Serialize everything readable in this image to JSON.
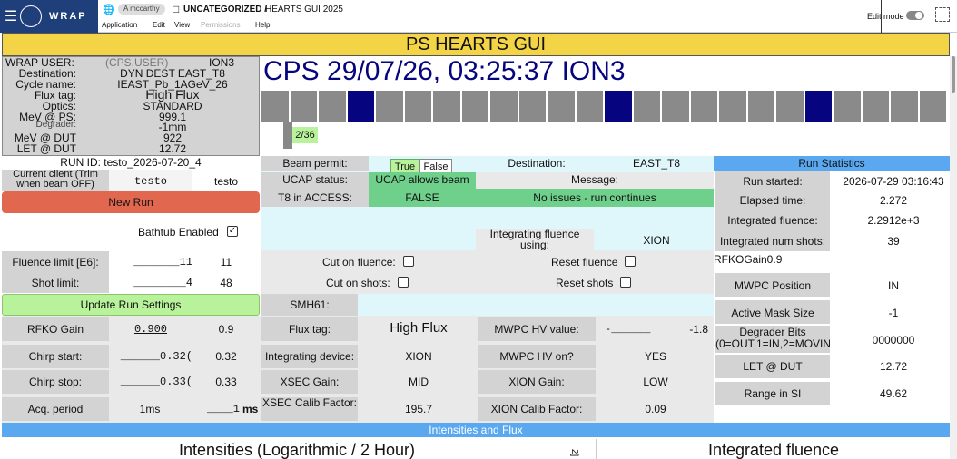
{
  "app": {
    "logo_text": "WRAP",
    "user_chip": "A mccarthy",
    "breadcrumb_folder": "UNCATEGORIZED /",
    "breadcrumb_page": "HEARTS GUI 2025",
    "menu": [
      "Application",
      "Edit",
      "View",
      "Permissions",
      "Help"
    ],
    "edit_mode_label": "Edit mode"
  },
  "banner": {
    "title": "PS HEARTS GUI"
  },
  "info": {
    "rows": [
      {
        "label": "WRAP USER:",
        "value": "(CPS.USER)",
        "extra": "ION3"
      },
      {
        "label": "Destination:",
        "value": "DYN DEST EAST_T8"
      },
      {
        "label": "Cycle name:",
        "value": "IEAST_Pb_1AGeV_26"
      },
      {
        "label": "Flux tag:",
        "value": "High Flux"
      },
      {
        "label": "Optics:",
        "value": "STANDARD"
      },
      {
        "label": "MeV @ PS:",
        "value": "999.1"
      },
      {
        "label": "Degrader:",
        "value": "-1mm"
      },
      {
        "label": "MeV @ DUT",
        "value": "922"
      },
      {
        "label": "LET @ DUT",
        "value": "12.72"
      }
    ]
  },
  "cps": {
    "title": "CPS 29/07/26, 03:25:37 ION3",
    "cycle_counter": "2/36",
    "cycle_progress": 0.056,
    "cycles": [
      "g",
      "g",
      "g",
      "n",
      "g",
      "g",
      "g",
      "g",
      "g",
      "g",
      "g",
      "g",
      "n",
      "g",
      "g",
      "g",
      "g",
      "g",
      "g",
      "n",
      "g",
      "g",
      "g",
      "g"
    ]
  },
  "run": {
    "run_id": "RUN ID: testo_2026-07-20_4",
    "client_label": "Current client (Trim when beam OFF)",
    "client_input": "testo",
    "client_value": "testo",
    "new_run": "New Run",
    "bathtub": "Bathtub Enabled",
    "fluence_label": "Fluence limit [E6]:",
    "fluence_input": "_______11",
    "fluence_value": "11",
    "shot_label": "Shot limit:",
    "shot_input": "________4",
    "shot_value": "48",
    "update": "Update Run Settings"
  },
  "beam": {
    "permit_label": "Beam permit:",
    "permit_true": "True",
    "permit_false": "False",
    "ucap_label": "UCAP status:",
    "ucap_value": "UCAP allows beam",
    "t8_label": "T8 in ACCESS:",
    "t8_value": "FALSE",
    "dest_label": "Destination:",
    "dest_value": "EAST_T8",
    "message_label": "Message:",
    "message_value": "No issues - run continues",
    "integrating_label": "Integrating fluence using:",
    "integrating_value": "XION",
    "cut_fluence": "Cut on fluence:",
    "reset_fluence": "Reset fluence",
    "cut_shots": "Cut on shots:",
    "reset_shots": "Reset shots",
    "smh": "SMH61:"
  },
  "stats": {
    "title": "Run Statistics",
    "rows": [
      {
        "label": "Run started:",
        "value": "2026-07-29 03:16:43"
      },
      {
        "label": "Elapsed time:",
        "value": "2.272"
      },
      {
        "label": "Integrated fluence:",
        "value": "2.2912e+3"
      },
      {
        "label": "Integrated num shots:",
        "value": "39"
      }
    ],
    "rfko": "RFKOGain0.9",
    "mwpc_rows": [
      {
        "label": "MWPC Position",
        "value": "IN"
      },
      {
        "label": "Active Mask Size",
        "value": "-1"
      },
      {
        "label": "Degrader Bits (0=OUT,1=IN,2=MOVING)",
        "value": "0000000"
      },
      {
        "label": "LET @ DUT",
        "value": "12.72"
      },
      {
        "label": "Range in SI",
        "value": "49.62"
      }
    ]
  },
  "params": {
    "rfko_label": "RFKO Gain",
    "rfko_input": "0.900",
    "rfko_value": "0.9",
    "chirp_start_label": "Chirp start:",
    "chirp_start_input": "______0.32(",
    "chirp_start_value": "0.32",
    "chirp_stop_label": "Chirp stop:",
    "chirp_stop_input": "______0.33(",
    "chirp_stop_value": "0.33",
    "acq_label": "Acq. period",
    "acq_value": "1ms",
    "acq_input": "____1",
    "acq_unit": "ms",
    "flux_label": "Flux tag:",
    "flux_value": "High Flux",
    "intdev_label": "Integrating device:",
    "intdev_value": "XION",
    "xsec_label": "XSEC Gain:",
    "xsec_value": "MID",
    "xsec_calib_label": "XSEC Calib Factor:",
    "xsec_calib_value": "195.7",
    "mwpc_hv_label": "MWPC HV value:",
    "mwpc_hv_input": "-______",
    "mwpc_hv_value": "-1.8",
    "mwpc_on_label": "MWPC HV on?",
    "mwpc_on_value": "YES",
    "xion_gain_label": "XION Gain:",
    "xion_gain_value": "LOW",
    "xion_calib_label": "XION Calib Factor:",
    "xion_calib_value": "0.09"
  },
  "footer": {
    "bar": "Intensities and Flux",
    "left_title": "Intensities (Logarithmic / 2 Hour)",
    "right_title": "Integrated fluence",
    "axis_snippet": "2]"
  },
  "colors": {
    "navy": "#06047e",
    "banner": "#f4d447",
    "green": "#6fd08c",
    "red": "#e2674f",
    "blue": "#5aa9f0"
  }
}
